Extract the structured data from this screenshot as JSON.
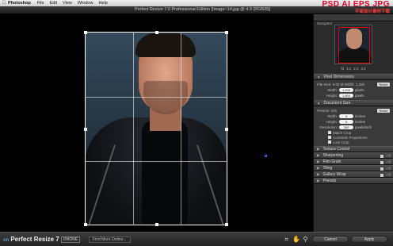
{
  "menubar": {
    "apple": "",
    "app": "Photoshop",
    "items": [
      "File",
      "Edit",
      "View",
      "Window",
      "Help"
    ]
  },
  "window": {
    "title": "Perfect Resize 7.0 Professional Edition [Image~14.jpg @ 4.9 (RGB/8)]"
  },
  "watermark": {
    "line1": "PSD AI EPS JPG",
    "line2": "平面设计素材下载",
    "cn": "优酷"
  },
  "navigator": {
    "tab": "Navigator",
    "zoom_items": [
      "fit",
      "1:1",
      "2:1",
      "4:1"
    ]
  },
  "pixel_dimensions": {
    "header": "Pixel Dimensions",
    "file_size_label": "File Size: 6.00 M  Width: 1,200",
    "reset": "Reset",
    "rows": [
      {
        "label": "Width:",
        "value": "1,200",
        "unit": "pixels"
      },
      {
        "label": "Height:",
        "value": "1,500",
        "unit": "pixels"
      }
    ]
  },
  "document_size": {
    "header": "Document Size",
    "reset": "Reset",
    "preset_label": "Presets: 4x5",
    "rows": [
      {
        "label": "Width:",
        "value": "4",
        "unit": "inches"
      },
      {
        "label": "Height:",
        "value": "5",
        "unit": "inches"
      },
      {
        "label": "Resolution:",
        "value": "300",
        "unit": "pixels/inch"
      }
    ],
    "checks": [
      "Match Crop",
      "Constrain Proportions",
      "Lock Crop"
    ]
  },
  "collapsed_sections": [
    {
      "label": "Texture Control",
      "has_toggle": false
    },
    {
      "label": "Sharpening",
      "has_toggle": true,
      "state": "Off"
    },
    {
      "label": "Film Grain",
      "has_toggle": true,
      "state": "Off"
    },
    {
      "label": "Tiling",
      "has_toggle": true,
      "state": "Off"
    },
    {
      "label": "Gallery Wrap",
      "has_toggle": true,
      "state": "Off"
    },
    {
      "label": "Presets",
      "has_toggle": false
    }
  ],
  "bottombar": {
    "on_label": "on",
    "product": "Perfect Resize 7",
    "brand": "ONONE",
    "find_more": "Find More Online...",
    "cancel": "Cancel",
    "apply": "Apply"
  }
}
